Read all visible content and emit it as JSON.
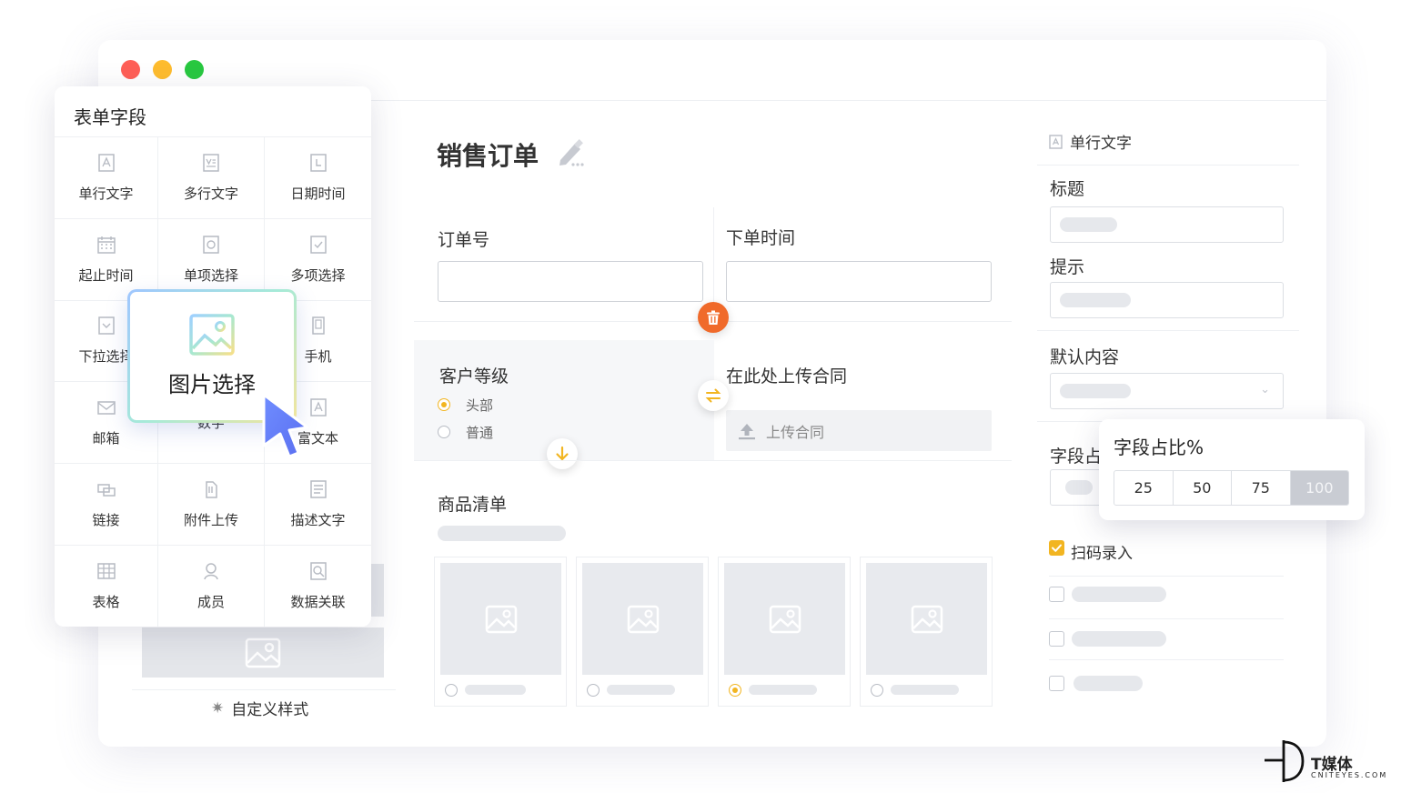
{
  "window": {
    "traffic_lights": [
      "#ff5f57",
      "#febc2e",
      "#28c840"
    ]
  },
  "palette": {
    "title": "表单字段",
    "items": [
      {
        "label": "单行文字",
        "icon": "single-line-text-icon"
      },
      {
        "label": "多行文字",
        "icon": "multi-line-text-icon"
      },
      {
        "label": "日期时间",
        "icon": "datetime-icon"
      },
      {
        "label": "起止时间",
        "icon": "date-range-icon"
      },
      {
        "label": "单项选择",
        "icon": "radio-icon"
      },
      {
        "label": "多项选择",
        "icon": "checkbox-icon"
      },
      {
        "label": "下拉选择",
        "icon": "dropdown-icon"
      },
      {
        "label": "",
        "icon": ""
      },
      {
        "label": "手机",
        "icon": "phone-icon"
      },
      {
        "label": "邮箱",
        "icon": "mail-icon"
      },
      {
        "label": "数字",
        "icon": ""
      },
      {
        "label": "富文本",
        "icon": "rich-text-icon"
      },
      {
        "label": "链接",
        "icon": "link-icon"
      },
      {
        "label": "附件上传",
        "icon": "attachment-icon"
      },
      {
        "label": "描述文字",
        "icon": "description-icon"
      },
      {
        "label": "表格",
        "icon": "table-icon"
      },
      {
        "label": "成员",
        "icon": "member-icon"
      },
      {
        "label": "数据关联",
        "icon": "data-link-icon"
      }
    ],
    "dragging_card": {
      "label": "图片选择",
      "icon": "image-select-icon"
    }
  },
  "left_footer": {
    "custom_style_label": "自定义样式"
  },
  "form": {
    "title": "销售订单",
    "order_no_label": "订单号",
    "order_time_label": "下单时间",
    "customer_level_label": "客户等级",
    "customer_level_options": [
      {
        "label": "头部",
        "selected": true
      },
      {
        "label": "普通",
        "selected": false
      }
    ],
    "upload_contract_label": "在此处上传合同",
    "upload_button_label": "上传合同",
    "product_list_label": "商品清单",
    "product_cards_selected": [
      false,
      false,
      true,
      false
    ]
  },
  "properties": {
    "field_type": "单行文字",
    "title_label": "标题",
    "hint_label": "提示",
    "default_label": "默认内容",
    "width_label": "字段占比%",
    "width_label_partial": "字段占",
    "width_options": [
      "25",
      "50",
      "75",
      "100"
    ],
    "width_selected": "100",
    "scan_input_label": "扫码录入",
    "scan_input_checked": true
  },
  "brand": {
    "name": "T媒体",
    "site": "CNITEYES.COM"
  },
  "colors": {
    "accent": "#f2b521",
    "delete": "#f06a2a"
  }
}
